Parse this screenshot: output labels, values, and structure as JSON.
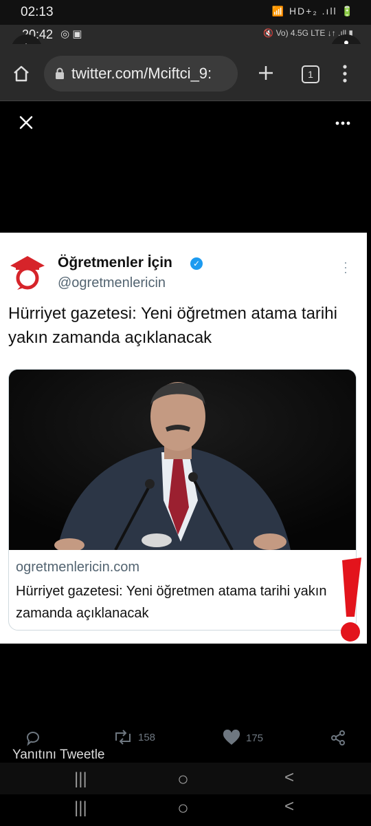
{
  "status_outer": {
    "time": "02:13",
    "icons": "📶 HD+₂ .ıll 🔋"
  },
  "status_inner": {
    "time": "20:42",
    "icons_left": "◎ ▣",
    "icons_right": "🔇 Vo) 4.5G LTE ↓↑ .ıll ▮"
  },
  "browser": {
    "url": "twitter.com/Mciftci_9:",
    "tab_count": "1"
  },
  "tweet_card": {
    "display_name": "Öğretmenler İçin",
    "verified_mark": "✓",
    "handle": "@ogretmenlericin",
    "text": "Hürriyet gazetesi: Yeni öğretmen atama tarihi yakın zamanda açıklanacak",
    "link_domain": "ogretmenlericin.com",
    "link_title": "Hürriyet gazetesi: Yeni öğretmen atama tarihi yakın zamanda açıklanacak"
  },
  "actions": {
    "retweet_count": "158",
    "like_count": "175"
  },
  "reply_placeholder": "Yanıtını Tweetle",
  "nav": {
    "recents": "|||",
    "home": "○",
    "back": "<"
  },
  "colors": {
    "accent_blue": "#1d9bf0",
    "logo_red": "#d6242a",
    "exclaim_red": "#e3141c"
  },
  "icons": [
    "back-arrow-icon",
    "home-icon",
    "lock-icon",
    "plus-icon",
    "menu-dots-icon",
    "close-icon",
    "reply-icon",
    "retweet-icon",
    "like-icon",
    "share-icon"
  ]
}
